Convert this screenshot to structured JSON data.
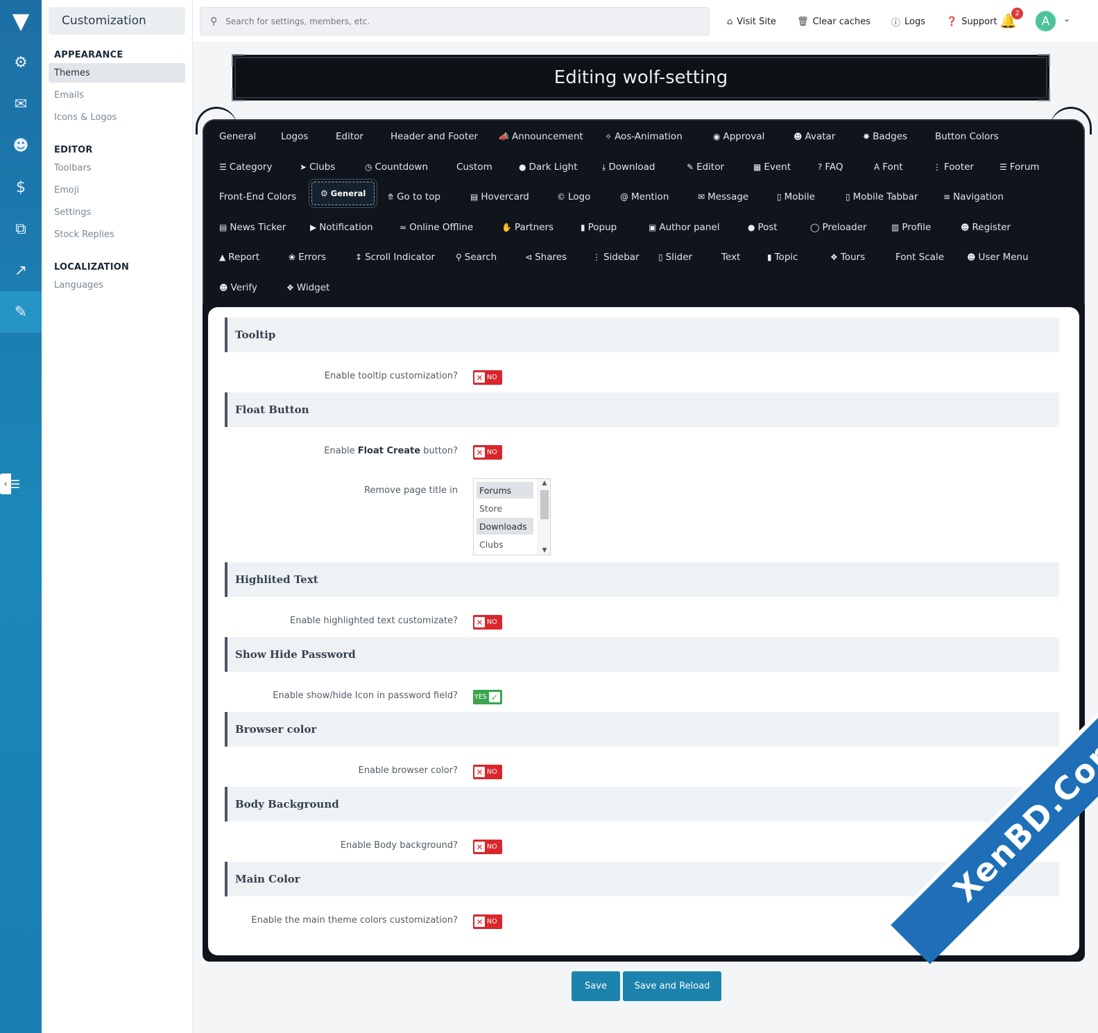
{
  "rail": {
    "items": [
      "settings-icon",
      "chat-icon",
      "user-icon",
      "dollar-icon",
      "copy-icon",
      "chart-icon",
      "brush-icon"
    ]
  },
  "sidebar": {
    "title": "Customization",
    "groups": [
      {
        "label": "APPEARANCE",
        "items": [
          "Themes",
          "Emails",
          "Icons & Logos"
        ]
      },
      {
        "label": "EDITOR",
        "items": [
          "Toolbars",
          "Emoji",
          "Settings",
          "Stock Replies"
        ]
      },
      {
        "label": "LOCALIZATION",
        "items": [
          "Languages"
        ]
      }
    ]
  },
  "header": {
    "search_placeholder": "Search for settings, members, etc.",
    "links": [
      "Visit Site",
      "Clear caches",
      "Logs",
      "Support"
    ],
    "notification_count": "2",
    "avatar_letter": "A"
  },
  "page": {
    "title": "Editing wolf-setting"
  },
  "tabs": {
    "row1": [
      "General",
      "Logos",
      "Editor",
      "Header and Footer",
      "Announcement",
      "Aos-Animation",
      "Approval",
      "Avatar",
      "Badges",
      "Button Colors"
    ],
    "row2": [
      "Category",
      "Clubs",
      "Countdown",
      "Custom",
      "Dark Light",
      "Download",
      "Editor",
      "Event",
      "FAQ",
      "Font",
      "Footer",
      "Forum"
    ],
    "row3": [
      "Front-End Colors",
      "General",
      "Go to top",
      "Hovercard",
      "Logo",
      "Mention",
      "Message",
      "Mobile",
      "Mobile Tabbar",
      "Navigation"
    ],
    "row4": [
      "News Ticker",
      "Notification",
      "Online Offline",
      "Partners",
      "Popup",
      "Author panel",
      "Post",
      "Preloader",
      "Profile",
      "Register"
    ],
    "row5": [
      "Report",
      "Errors",
      "Scroll Indicator",
      "Search",
      "Shares",
      "Sidebar",
      "Slider",
      "Text",
      "Topic",
      "Tours",
      "Font Scale",
      "User Menu"
    ],
    "row6": [
      "Verify",
      "Widget"
    ]
  },
  "sections": {
    "tooltip": {
      "title": "Tooltip",
      "label": "Enable tooltip customization?",
      "value": "NO"
    },
    "float": {
      "title": "Float Button",
      "label_pre": "Enable ",
      "label_bold": "Float Create",
      "label_post": " button?",
      "value": "NO",
      "remove_label": "Remove page title in",
      "options": [
        "Forums",
        "Store",
        "Downloads",
        "Clubs"
      ],
      "selected": [
        "Forums",
        "Downloads"
      ]
    },
    "highlight": {
      "title": "Highlited Text",
      "label": "Enable highlighted text customizate?",
      "value": "NO"
    },
    "password": {
      "title": "Show Hide Password",
      "label": "Enable show/hide Icon in password field?",
      "value": "YES"
    },
    "browser": {
      "title": "Browser color",
      "label": "Enable browser color?",
      "value": "NO"
    },
    "body": {
      "title": "Body Background",
      "label": "Enable Body background?",
      "value": "NO"
    },
    "main": {
      "title": "Main Color",
      "label": "Enable the main theme colors customization?",
      "value": "NO"
    }
  },
  "buttons": {
    "save": "Save",
    "save_reload": "Save and Reload"
  },
  "watermark": "XenBD.Com",
  "colors": {
    "rail": "#1b87b8",
    "accent": "#1b83ad",
    "no": "#d9272b",
    "yes": "#3aa54d",
    "panel": "#0f151b"
  }
}
